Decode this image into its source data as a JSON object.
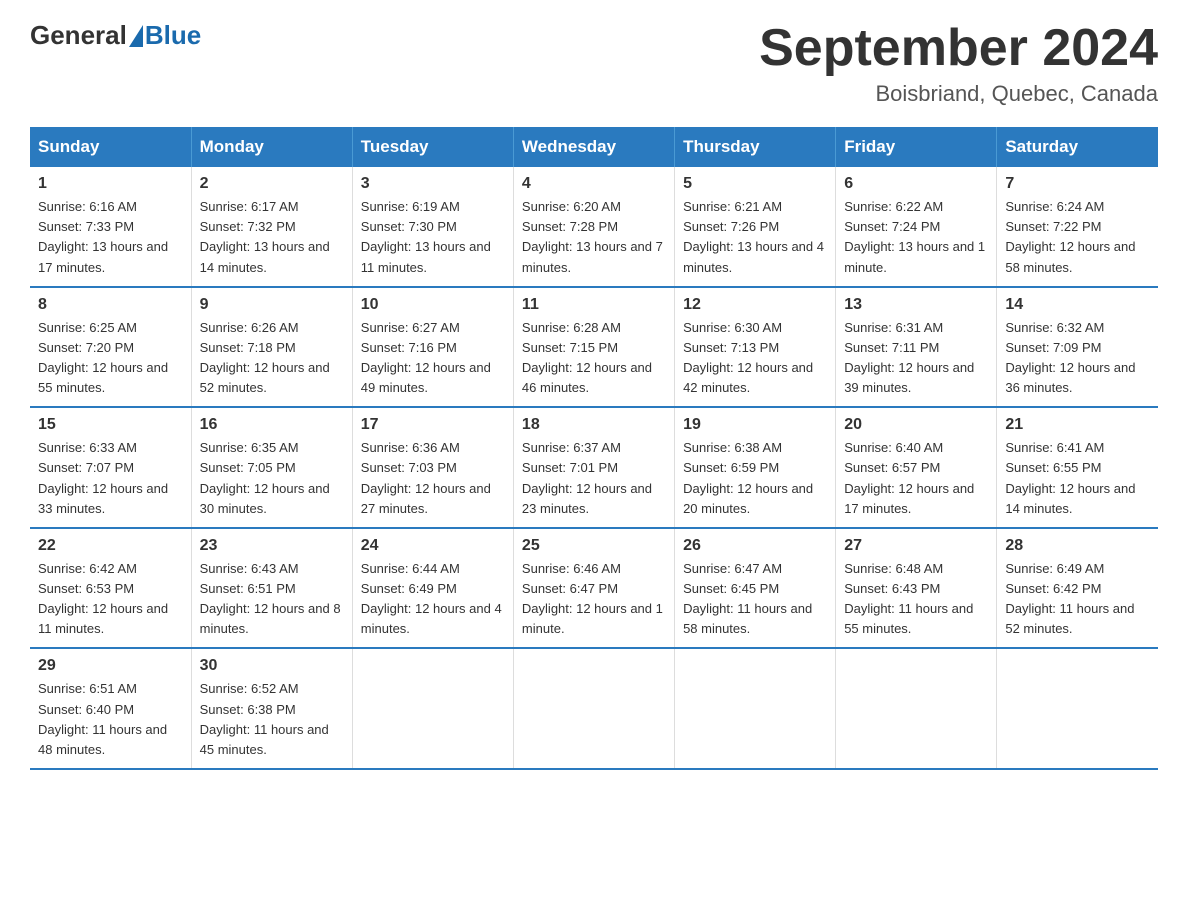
{
  "header": {
    "logo_general": "General",
    "logo_blue": "Blue",
    "month_title": "September 2024",
    "location": "Boisbriand, Quebec, Canada"
  },
  "days_of_week": [
    "Sunday",
    "Monday",
    "Tuesday",
    "Wednesday",
    "Thursday",
    "Friday",
    "Saturday"
  ],
  "weeks": [
    [
      {
        "day": "1",
        "sunrise": "Sunrise: 6:16 AM",
        "sunset": "Sunset: 7:33 PM",
        "daylight": "Daylight: 13 hours and 17 minutes."
      },
      {
        "day": "2",
        "sunrise": "Sunrise: 6:17 AM",
        "sunset": "Sunset: 7:32 PM",
        "daylight": "Daylight: 13 hours and 14 minutes."
      },
      {
        "day": "3",
        "sunrise": "Sunrise: 6:19 AM",
        "sunset": "Sunset: 7:30 PM",
        "daylight": "Daylight: 13 hours and 11 minutes."
      },
      {
        "day": "4",
        "sunrise": "Sunrise: 6:20 AM",
        "sunset": "Sunset: 7:28 PM",
        "daylight": "Daylight: 13 hours and 7 minutes."
      },
      {
        "day": "5",
        "sunrise": "Sunrise: 6:21 AM",
        "sunset": "Sunset: 7:26 PM",
        "daylight": "Daylight: 13 hours and 4 minutes."
      },
      {
        "day": "6",
        "sunrise": "Sunrise: 6:22 AM",
        "sunset": "Sunset: 7:24 PM",
        "daylight": "Daylight: 13 hours and 1 minute."
      },
      {
        "day": "7",
        "sunrise": "Sunrise: 6:24 AM",
        "sunset": "Sunset: 7:22 PM",
        "daylight": "Daylight: 12 hours and 58 minutes."
      }
    ],
    [
      {
        "day": "8",
        "sunrise": "Sunrise: 6:25 AM",
        "sunset": "Sunset: 7:20 PM",
        "daylight": "Daylight: 12 hours and 55 minutes."
      },
      {
        "day": "9",
        "sunrise": "Sunrise: 6:26 AM",
        "sunset": "Sunset: 7:18 PM",
        "daylight": "Daylight: 12 hours and 52 minutes."
      },
      {
        "day": "10",
        "sunrise": "Sunrise: 6:27 AM",
        "sunset": "Sunset: 7:16 PM",
        "daylight": "Daylight: 12 hours and 49 minutes."
      },
      {
        "day": "11",
        "sunrise": "Sunrise: 6:28 AM",
        "sunset": "Sunset: 7:15 PM",
        "daylight": "Daylight: 12 hours and 46 minutes."
      },
      {
        "day": "12",
        "sunrise": "Sunrise: 6:30 AM",
        "sunset": "Sunset: 7:13 PM",
        "daylight": "Daylight: 12 hours and 42 minutes."
      },
      {
        "day": "13",
        "sunrise": "Sunrise: 6:31 AM",
        "sunset": "Sunset: 7:11 PM",
        "daylight": "Daylight: 12 hours and 39 minutes."
      },
      {
        "day": "14",
        "sunrise": "Sunrise: 6:32 AM",
        "sunset": "Sunset: 7:09 PM",
        "daylight": "Daylight: 12 hours and 36 minutes."
      }
    ],
    [
      {
        "day": "15",
        "sunrise": "Sunrise: 6:33 AM",
        "sunset": "Sunset: 7:07 PM",
        "daylight": "Daylight: 12 hours and 33 minutes."
      },
      {
        "day": "16",
        "sunrise": "Sunrise: 6:35 AM",
        "sunset": "Sunset: 7:05 PM",
        "daylight": "Daylight: 12 hours and 30 minutes."
      },
      {
        "day": "17",
        "sunrise": "Sunrise: 6:36 AM",
        "sunset": "Sunset: 7:03 PM",
        "daylight": "Daylight: 12 hours and 27 minutes."
      },
      {
        "day": "18",
        "sunrise": "Sunrise: 6:37 AM",
        "sunset": "Sunset: 7:01 PM",
        "daylight": "Daylight: 12 hours and 23 minutes."
      },
      {
        "day": "19",
        "sunrise": "Sunrise: 6:38 AM",
        "sunset": "Sunset: 6:59 PM",
        "daylight": "Daylight: 12 hours and 20 minutes."
      },
      {
        "day": "20",
        "sunrise": "Sunrise: 6:40 AM",
        "sunset": "Sunset: 6:57 PM",
        "daylight": "Daylight: 12 hours and 17 minutes."
      },
      {
        "day": "21",
        "sunrise": "Sunrise: 6:41 AM",
        "sunset": "Sunset: 6:55 PM",
        "daylight": "Daylight: 12 hours and 14 minutes."
      }
    ],
    [
      {
        "day": "22",
        "sunrise": "Sunrise: 6:42 AM",
        "sunset": "Sunset: 6:53 PM",
        "daylight": "Daylight: 12 hours and 11 minutes."
      },
      {
        "day": "23",
        "sunrise": "Sunrise: 6:43 AM",
        "sunset": "Sunset: 6:51 PM",
        "daylight": "Daylight: 12 hours and 8 minutes."
      },
      {
        "day": "24",
        "sunrise": "Sunrise: 6:44 AM",
        "sunset": "Sunset: 6:49 PM",
        "daylight": "Daylight: 12 hours and 4 minutes."
      },
      {
        "day": "25",
        "sunrise": "Sunrise: 6:46 AM",
        "sunset": "Sunset: 6:47 PM",
        "daylight": "Daylight: 12 hours and 1 minute."
      },
      {
        "day": "26",
        "sunrise": "Sunrise: 6:47 AM",
        "sunset": "Sunset: 6:45 PM",
        "daylight": "Daylight: 11 hours and 58 minutes."
      },
      {
        "day": "27",
        "sunrise": "Sunrise: 6:48 AM",
        "sunset": "Sunset: 6:43 PM",
        "daylight": "Daylight: 11 hours and 55 minutes."
      },
      {
        "day": "28",
        "sunrise": "Sunrise: 6:49 AM",
        "sunset": "Sunset: 6:42 PM",
        "daylight": "Daylight: 11 hours and 52 minutes."
      }
    ],
    [
      {
        "day": "29",
        "sunrise": "Sunrise: 6:51 AM",
        "sunset": "Sunset: 6:40 PM",
        "daylight": "Daylight: 11 hours and 48 minutes."
      },
      {
        "day": "30",
        "sunrise": "Sunrise: 6:52 AM",
        "sunset": "Sunset: 6:38 PM",
        "daylight": "Daylight: 11 hours and 45 minutes."
      },
      null,
      null,
      null,
      null,
      null
    ]
  ]
}
